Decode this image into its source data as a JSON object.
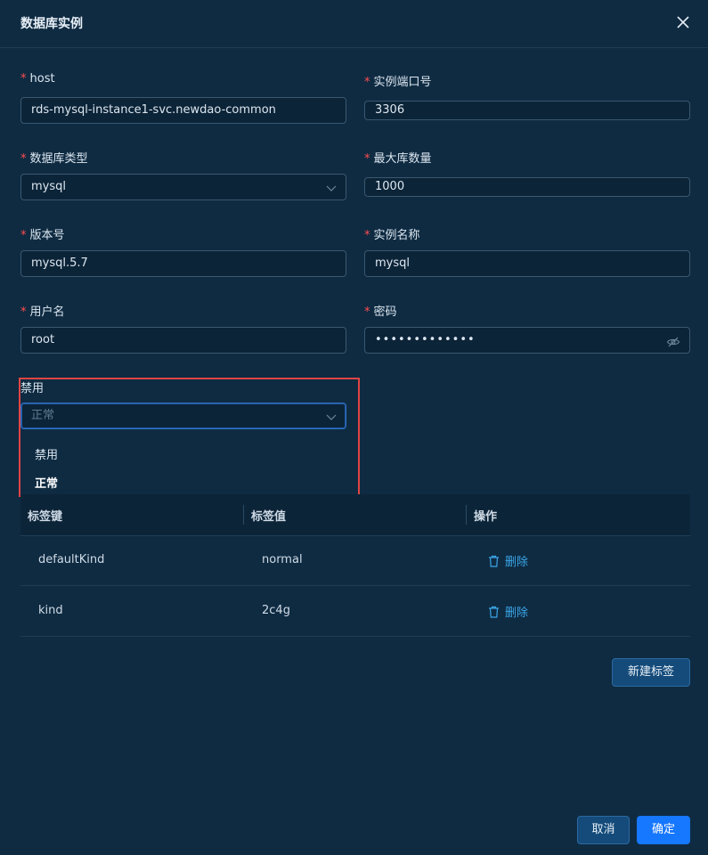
{
  "dialog": {
    "title": "数据库实例"
  },
  "form": {
    "host": {
      "label": "host",
      "value": "rds-mysql-instance1-svc.newdao-common"
    },
    "port": {
      "label": "实例端口号",
      "value": "3306"
    },
    "db_type": {
      "label": "数据库类型",
      "value": "mysql"
    },
    "max_db": {
      "label": "最大库数量",
      "value": "1000"
    },
    "version": {
      "label": "版本号",
      "value": "mysql.5.7"
    },
    "instance_name": {
      "label": "实例名称",
      "value": "mysql"
    },
    "username": {
      "label": "用户名",
      "value": "root"
    },
    "password": {
      "label": "密码",
      "value": "•••••••••••••"
    },
    "disabled": {
      "label": "禁用",
      "placeholder": "正常",
      "options": [
        "禁用",
        "正常"
      ],
      "selected_index": 1
    },
    "required_mark": "*"
  },
  "tags_table": {
    "headers": [
      "标签键",
      "标签值",
      "操作"
    ],
    "rows": [
      {
        "key": "defaultKind",
        "value": "normal",
        "action": "删除"
      },
      {
        "key": "kind",
        "value": "2c4g",
        "action": "删除"
      }
    ]
  },
  "buttons": {
    "new_tag": "新建标签",
    "cancel": "取消",
    "ok": "确定"
  },
  "colors": {
    "accent": "#1677ff",
    "link": "#3aa6e8",
    "required": "#ff4d4f",
    "highlight": "#e04545"
  },
  "icons": {
    "close": "close-icon",
    "dropdown": "chevron-down-icon",
    "password_toggle": "eye-off-icon",
    "delete": "trash-icon"
  }
}
